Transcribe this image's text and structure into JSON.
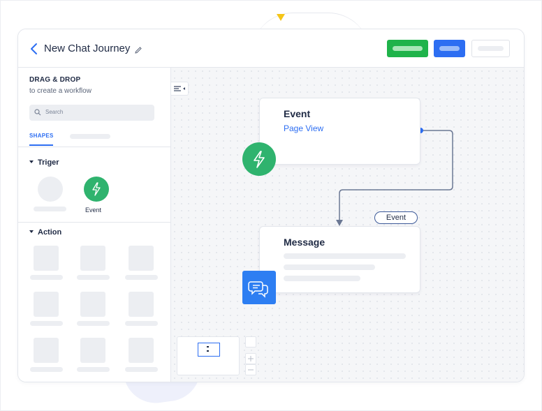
{
  "header": {
    "title": "New Chat Journey"
  },
  "sidebar": {
    "drag_title": "DRAG & DROP",
    "drag_subtitle": "to create a workflow",
    "search_placeholder": "Search",
    "tab_shapes": "SHAPES",
    "section_trigger": "Triger",
    "section_action": "Action",
    "event_shape_label": "Event"
  },
  "canvas": {
    "event_node": {
      "title": "Event",
      "subtitle": "Page View"
    },
    "message_node": {
      "title": "Message"
    },
    "edge_label": "Event"
  },
  "colors": {
    "green_button": "#1fb34a",
    "blue_button": "#2d6ef2",
    "event_badge": "#2fb36e",
    "message_badge": "#2d7ef2",
    "accent": "#2d6ef2",
    "connector": "#6b7894"
  },
  "icons": {
    "back": "chevron-left-icon",
    "edit": "pencil-icon",
    "search": "search-icon",
    "event": "lightning-icon",
    "message": "chat-bubbles-icon",
    "collapse": "collapse-panel-icon",
    "zoom_in": "plus-icon",
    "zoom_out": "minus-icon"
  }
}
